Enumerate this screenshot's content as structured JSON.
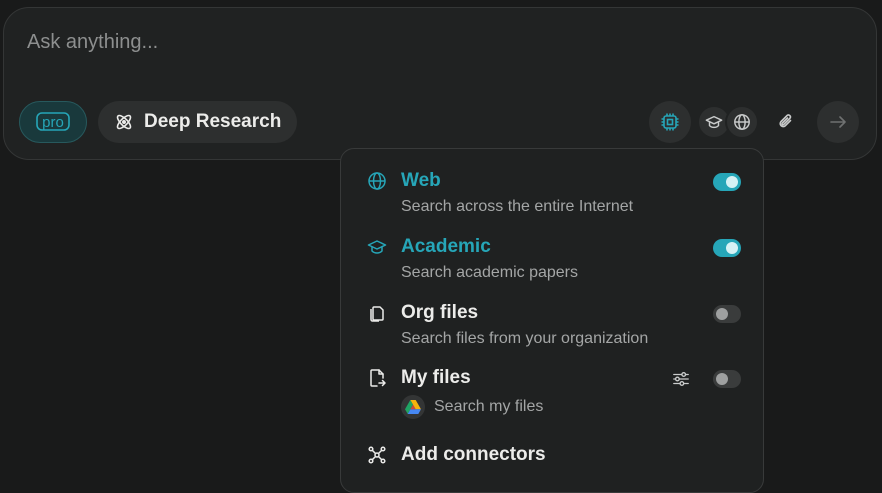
{
  "composer": {
    "placeholder": "Ask anything...",
    "pro_label": "pro",
    "deep_research_label": "Deep Research"
  },
  "colors": {
    "accent": "#26a6b8",
    "background": "#191a1a",
    "surface": "#202222",
    "text": "#ececea",
    "muted": "#a4a6a6"
  },
  "toolbar_icons": [
    "chip-icon",
    "graduation-cap-icon",
    "globe-icon",
    "paperclip-icon",
    "arrow-right-icon"
  ],
  "sources_menu": {
    "items": [
      {
        "title": "Web",
        "desc": "Search across the entire Internet",
        "icon": "globe-icon",
        "enabled": true
      },
      {
        "title": "Academic",
        "desc": "Search academic papers",
        "icon": "graduation-cap-icon",
        "enabled": true
      },
      {
        "title": "Org files",
        "desc": "Search files from your organization",
        "icon": "files-icon",
        "enabled": false
      },
      {
        "title": "My files",
        "desc": "Search my files",
        "icon": "file-export-icon",
        "enabled": false
      }
    ],
    "add_connectors": "Add connectors"
  }
}
